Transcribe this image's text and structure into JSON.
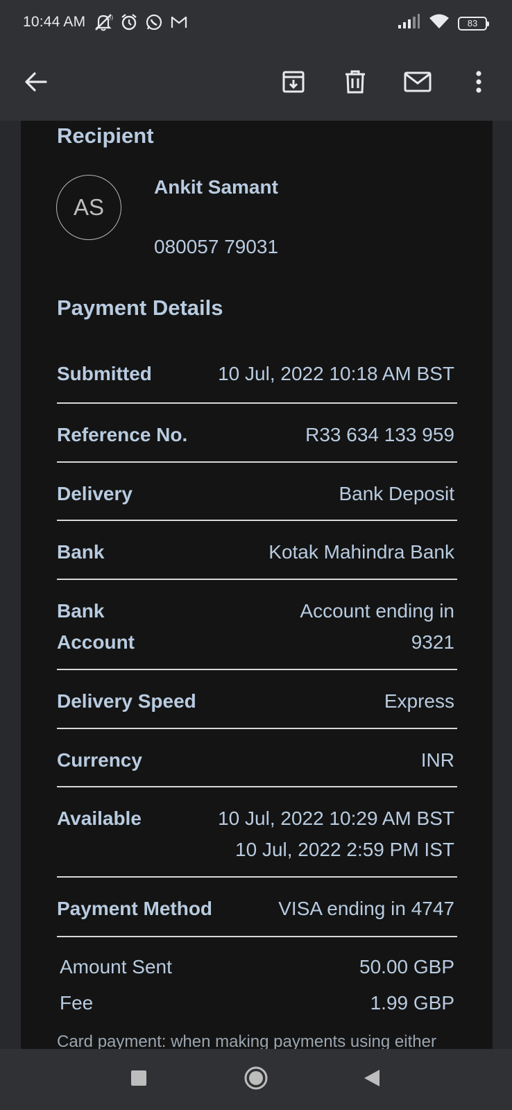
{
  "status_bar": {
    "time": "10:44 AM",
    "battery": "83",
    "icons_left": [
      "notifications-off-icon",
      "alarm-icon",
      "whatsapp-icon",
      "gmail-icon"
    ],
    "icons_right": [
      "signal-icon",
      "wifi-icon",
      "battery-icon"
    ]
  },
  "toolbar": {
    "icons": [
      "back-arrow-icon",
      "archive-icon",
      "delete-icon",
      "mark-unread-icon",
      "more-vert-icon"
    ]
  },
  "recipient": {
    "title": "Recipient",
    "initials": "AS",
    "name": "Ankit Samant",
    "phone": "080057 79031"
  },
  "payment_details": {
    "title": "Payment Details",
    "rows": [
      {
        "label": "Submitted",
        "value": "10 Jul, 2022 10:18 AM BST"
      },
      {
        "label": "Reference No.",
        "value": "R33 634 133 959"
      },
      {
        "label": "Delivery",
        "value": "Bank Deposit"
      },
      {
        "label": "Bank",
        "value": "Kotak Mahindra Bank"
      },
      {
        "label_line1": "Bank",
        "label_line2": "Account",
        "value_line1": "Account ending in",
        "value_line2": "9321"
      },
      {
        "label": "Delivery Speed",
        "value": "Express"
      },
      {
        "label": "Currency",
        "value": "INR"
      },
      {
        "label": "Available",
        "value_line1": "10 Jul, 2022 10:29 AM BST",
        "value_line2": "10 Jul, 2022 2:59 PM IST"
      },
      {
        "label": "Payment Method",
        "value": "VISA ending in 4747"
      }
    ]
  },
  "amounts": [
    {
      "label": "Amount Sent",
      "value": "50.00 GBP"
    },
    {
      "label": "Fee",
      "value": "1.99 GBP"
    }
  ],
  "footnote_cut": "Card payment: when making payments using either"
}
